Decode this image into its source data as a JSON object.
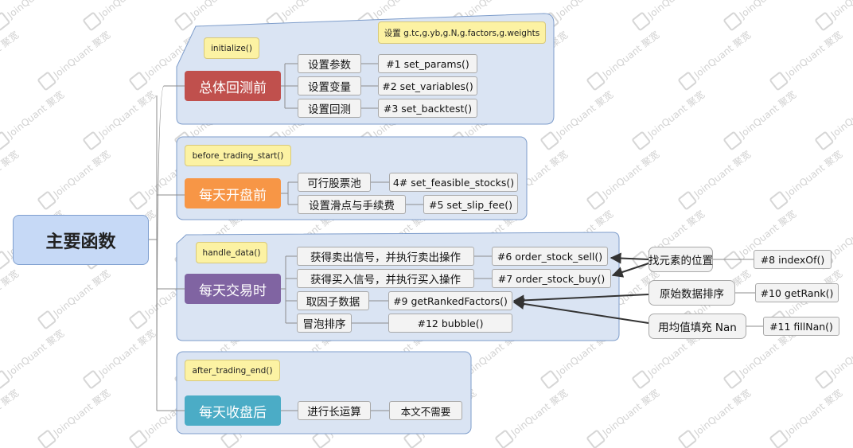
{
  "root": {
    "label": "主要函数"
  },
  "groups": [
    {
      "category": "总体回测前",
      "color": "#c0504d",
      "note": "initialize()",
      "extra_note": "设置 g.tc,g.yb,g.N,g.factors,g.weights",
      "items": [
        {
          "label": "设置参数",
          "fn": "#1  set_params()"
        },
        {
          "label": "设置变量",
          "fn": "#2  set_variables()"
        },
        {
          "label": "设置回测",
          "fn": "#3  set_backtest()"
        }
      ]
    },
    {
      "category": "每天开盘前",
      "color": "#f79646",
      "note": "before_trading_start()",
      "items": [
        {
          "label": "可行股票池",
          "fn": "4#  set_feasible_stocks()"
        },
        {
          "label": "设置滑点与手续费",
          "fn": "#5  set_slip_fee()"
        }
      ]
    },
    {
      "category": "每天交易时",
      "color": "#8064a2",
      "note": "handle_data()",
      "items": [
        {
          "label": "获得卖出信号，并执行卖出操作",
          "fn": "#6  order_stock_sell()"
        },
        {
          "label": "获得买入信号，并执行买入操作",
          "fn": "#7  order_stock_buy()"
        },
        {
          "label": "取因子数据",
          "fn": "#9 getRankedFactors()"
        },
        {
          "label": "冒泡排序",
          "fn": "#12  bubble()"
        }
      ]
    },
    {
      "category": "每天收盘后",
      "color": "#4bacc6",
      "note": "after_trading_end()",
      "items": [
        {
          "label": "进行长运算",
          "fn": "本文不需要"
        }
      ]
    }
  ],
  "helpers": [
    {
      "label": "找元素的位置",
      "fn": "#8  indexOf()"
    },
    {
      "label": "原始数据排序",
      "fn": "#10  getRank()"
    },
    {
      "label": "用均值填充 Nan",
      "fn": "#11  fillNan()"
    }
  ],
  "watermark": "JoinQuant 聚宽"
}
